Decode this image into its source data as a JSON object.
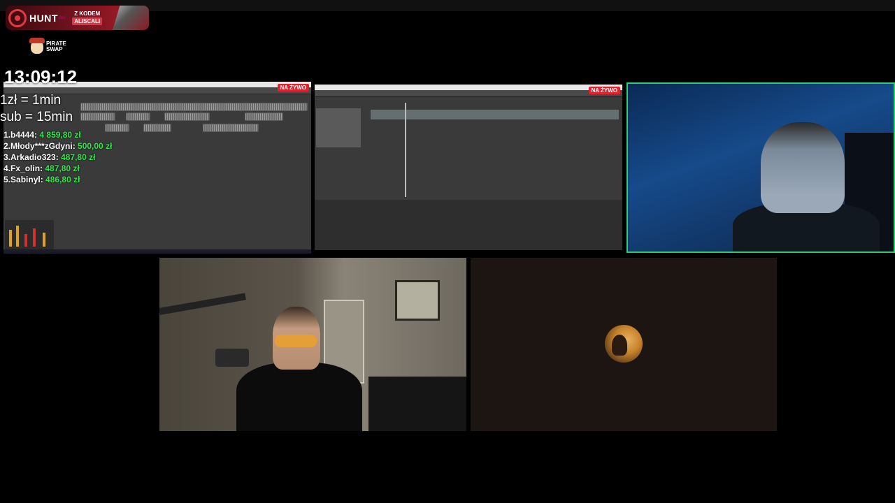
{
  "sponsor": {
    "brand": "HUNT",
    "brand_sup": "GG",
    "code_label": "Z KODEM",
    "code_value": "ALISCALI"
  },
  "partner": {
    "line1": "PIRATE",
    "line2": "SWAP"
  },
  "overlay": {
    "clock": "13:09:12",
    "rate_money": "1zł = 1min",
    "rate_sub": "sub = 15min",
    "leaderboard": [
      {
        "rank": "1.",
        "name": "b4444:",
        "amount": "4 859,80 zł"
      },
      {
        "rank": "2.",
        "name": "Młody***zGdyni:",
        "amount": "500,00 zł"
      },
      {
        "rank": "3.",
        "name": "Arkadio323:",
        "amount": "487,80 zł"
      },
      {
        "rank": "4.",
        "name": "Fx_olin:",
        "amount": "487,80 zł"
      },
      {
        "rank": "5.",
        "name": "Sabinyl:",
        "amount": "486,80 zł"
      }
    ]
  },
  "screens": [
    {
      "live_label": "NA ŻYWO"
    },
    {
      "live_label": "NA ŻYWO"
    }
  ],
  "colors": {
    "accent_green": "#2ee84b",
    "live_red": "#e0232e",
    "speaking_border": "#2ecc71"
  }
}
